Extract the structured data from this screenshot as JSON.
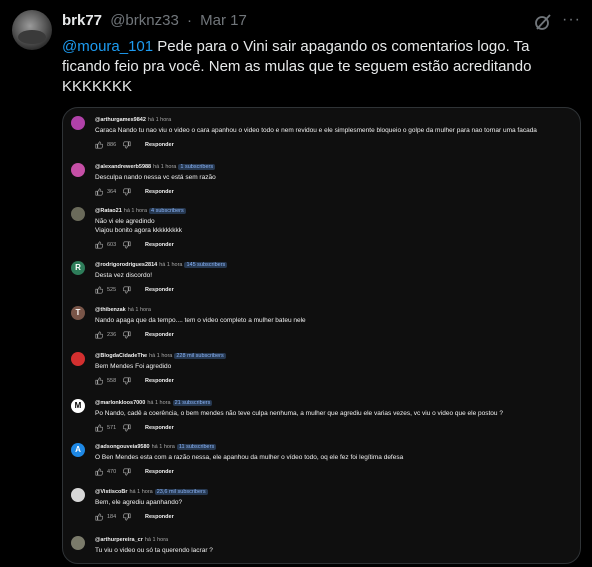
{
  "tweet": {
    "display_name": "brk77",
    "handle": "@brknz33",
    "separator": "·",
    "date": "Mar 17",
    "more_label": "···",
    "mention": "@moura_101",
    "body": " Pede para o Vini sair apagando os comentarios logo. Ta ficando feio pra você. Nem as mulas que te seguem estão acreditando KKKKKKK"
  },
  "reply_label": "Responder",
  "comments": [
    {
      "user": "@arthurgames9842",
      "time": "há 1 hora",
      "subs": "",
      "text": "Caraca Nando tu nao viu o video o cara apanhou o video todo e nem revidou e ele simplesmente bloqueio o golpe da mulher para nao tornar uma facada",
      "likes": "886",
      "avatar_color": "#b041a8",
      "avatar_letter": ""
    },
    {
      "user": "@alexandrewerb5988",
      "time": "há 1 hora",
      "subs": "1 subscribers",
      "text": "Desculpa nando nessa vc está sem razão",
      "likes": "364",
      "avatar_color": "#c54fa6",
      "avatar_letter": ""
    },
    {
      "user": "@Ratao21",
      "time": "há 1 hora",
      "subs": "4 subscribers",
      "text": "Não vi ele agredindo\nViajou bonito agora kkkkkkkkk",
      "likes": "603",
      "avatar_color": "#6a6a5a",
      "avatar_letter": ""
    },
    {
      "user": "@rodrigorodrigues2814",
      "time": "há 1 hora",
      "subs": "145 subscribers",
      "text": "Desta vez discordo!",
      "likes": "525",
      "avatar_color": "#2e7d5a",
      "avatar_letter": "R"
    },
    {
      "user": "@thibenzak",
      "time": "há 1 hora",
      "subs": "",
      "text": "Nando apaga que da tempo.... tem o video completo a mulher bateu nele",
      "likes": "236",
      "avatar_color": "#795548",
      "avatar_letter": "T"
    },
    {
      "user": "@BlogdaCidadeThe",
      "time": "há 1 hora",
      "subs": "228 mil subscribers",
      "text": "Bem Mendes Foi agredido",
      "likes": "558",
      "avatar_color": "#d32f2f",
      "avatar_letter": ""
    },
    {
      "user": "@marlonkloos7000",
      "time": "há 1 hora",
      "subs": "21 subscribers",
      "text": "Po Nando, cadê a coerência, o bem mendes não teve culpa nenhuma, a mulher que agrediu ele varias vezes, vc viu o video que ele postou ?",
      "likes": "571",
      "avatar_color": "#ffffff",
      "avatar_letter": "M"
    },
    {
      "user": "@adsongouveia9580",
      "time": "há 1 hora",
      "subs": "11 subscribers",
      "text": "O Ben Mendes esta com a razão nessa, ele apanhou da mulher o vídeo todo, oq ele fez foi legítima defesa",
      "likes": "470",
      "avatar_color": "#1e88e5",
      "avatar_letter": "A"
    },
    {
      "user": "@VistiscoBr",
      "time": "há 1 hora",
      "subs": "23,6 mil subscribers",
      "text": "Bem, ele agrediu apanhando?",
      "likes": "184",
      "avatar_color": "#d7d7d7",
      "avatar_letter": ""
    },
    {
      "user": "@arthurpereira_cr",
      "time": "há 1 hora",
      "subs": "",
      "text": "Tu viu o video ou só ta querendo lacrar ?",
      "likes": "",
      "avatar_color": "#7a7a6a",
      "avatar_letter": ""
    }
  ]
}
